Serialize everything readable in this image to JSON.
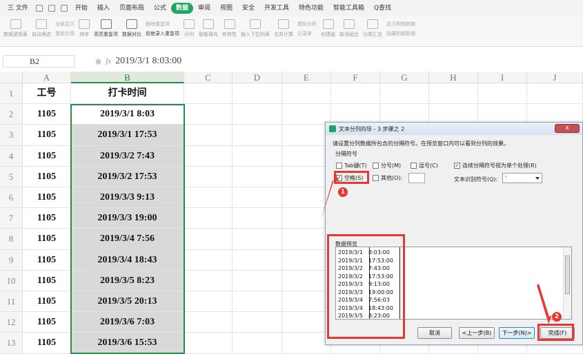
{
  "menu": {
    "file_label": "三 文件",
    "tabs": [
      "开始",
      "插入",
      "页面布局",
      "公式",
      "数据",
      "审阅",
      "视图",
      "安全",
      "开发工具",
      "特色功能",
      "智能工具箱"
    ],
    "active_tab": "数据",
    "search_label": "Q查找"
  },
  "ribbon": {
    "pivot": "数据透视表",
    "auto_filter": "自动筛选",
    "show_all": "全部显示",
    "reapply": "重新应用",
    "sort": "排序",
    "highlight_dup": "高亮重复项",
    "compare": "数据对比",
    "remove_dup": "删除重复项",
    "reject_dup": "拒绝录入重复项",
    "split": "分列",
    "smart_fill": "智能填充",
    "validity": "有效性",
    "dropdown": "插入下拉列表",
    "consolidate": "合并计算",
    "simulate": "模拟分析",
    "record": "记录单",
    "group": "创建组",
    "ungroup": "取消组合",
    "subtotal": "分类汇总",
    "show_detail": "显示明细数据",
    "hide_detail": "隐藏明细数据"
  },
  "formula_bar": {
    "cell_ref": "B2",
    "fx": "fx",
    "value": "2019/3/1 8:03:00"
  },
  "columns": [
    "A",
    "B",
    "C",
    "D",
    "E",
    "F",
    "G",
    "H",
    "I",
    "J"
  ],
  "selected_column": "B",
  "rows": [
    {
      "num": "1",
      "a": "工号",
      "b": "打卡时间"
    },
    {
      "num": "2",
      "a": "1105",
      "b": "2019/3/1 8:03"
    },
    {
      "num": "3",
      "a": "1105",
      "b": "2019/3/1 17:53"
    },
    {
      "num": "4",
      "a": "1105",
      "b": "2019/3/2 7:43"
    },
    {
      "num": "5",
      "a": "1105",
      "b": "2019/3/2 17:53"
    },
    {
      "num": "6",
      "a": "1105",
      "b": "2019/3/3 9:13"
    },
    {
      "num": "7",
      "a": "1105",
      "b": "2019/3/3 19:00"
    },
    {
      "num": "8",
      "a": "1105",
      "b": "2019/3/4 7:56"
    },
    {
      "num": "9",
      "a": "1105",
      "b": "2019/3/4 18:43"
    },
    {
      "num": "10",
      "a": "1105",
      "b": "2019/3/5 8:23"
    },
    {
      "num": "11",
      "a": "1105",
      "b": "2019/3/5 20:13"
    },
    {
      "num": "12",
      "a": "1105",
      "b": "2019/3/6 7:03"
    },
    {
      "num": "13",
      "a": "1105",
      "b": "2019/3/6 15:53"
    }
  ],
  "dialog": {
    "title": "文本分列向导 - 3 步骤之 2",
    "close": "x",
    "instruction": "请设置分列数据所包含的分隔符号。在预览窗口内可以看到分列的效果。",
    "group_label": "分隔符号",
    "tab_label": "Tab键(T)",
    "semicolon_label": "分号(M)",
    "comma_label": "逗号(C)",
    "space_label": "空格(S)",
    "other_label": "其他(O):",
    "consecutive_label": "连续分隔符号视为单个处理(R)",
    "qualifier_label": "文本识别符号(Q):",
    "qualifier_value": "'",
    "preview_label": "数据预览",
    "preview_rows": [
      [
        "2019/3/1",
        "8:03:00"
      ],
      [
        "2019/3/1",
        "17:53:00"
      ],
      [
        "2019/3/2",
        "7:43:00"
      ],
      [
        "2019/3/2",
        "17:53:00"
      ],
      [
        "2019/3/3",
        "9:13:00"
      ],
      [
        "2019/3/3",
        "19:00:00"
      ],
      [
        "2019/3/4",
        "7:56:03"
      ],
      [
        "2019/3/4",
        "18:43:00"
      ],
      [
        "2019/3/5",
        "8:23:00"
      ]
    ],
    "cancel": "取消",
    "back": "<上一步(B)",
    "next": "下一步(N)>",
    "finish": "完成(F)"
  },
  "annotations": {
    "badge1": "1",
    "badge2": "2"
  },
  "colors": {
    "accent_green": "#1fa463",
    "annotation_red": "#e53935",
    "selection_fill": "#d9d9d9"
  }
}
